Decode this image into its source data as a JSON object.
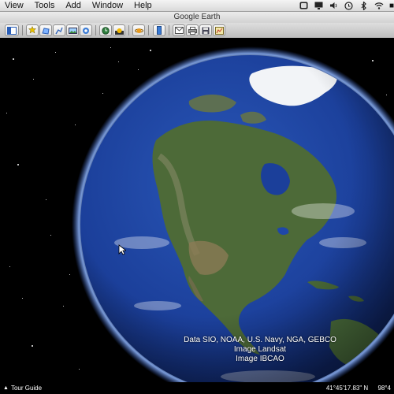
{
  "menu": {
    "items": [
      "View",
      "Tools",
      "Add",
      "Window",
      "Help"
    ]
  },
  "status": {
    "icons": [
      "app-status-icon",
      "display-icon",
      "volume-icon",
      "clock-icon",
      "bluetooth-icon",
      "wifi-icon",
      "battery-icon"
    ],
    "battery": "■"
  },
  "window": {
    "title": "Google Earth"
  },
  "toolbar": {
    "buttons": [
      "sidebar-toggle-icon",
      "placemark-icon",
      "polygon-icon",
      "path-icon",
      "image-overlay-icon",
      "record-tour-icon",
      "historical-imagery-icon",
      "sunlight-icon",
      "planets-icon",
      "ruler-icon",
      "email-icon",
      "print-icon",
      "save-image-icon",
      "view-in-maps-icon"
    ]
  },
  "attribution": {
    "line1": "Data SIO, NOAA, U.S. Navy, NGA, GEBCO",
    "line2": "Image Landsat",
    "line3": "Image IBCAO"
  },
  "bottom": {
    "tour_guide": "Tour Guide",
    "latitude": "41°45'17.83\" N",
    "longitude": "98°4"
  },
  "colors": {
    "ocean": "#1b3f9a",
    "atmosphere": "#6f9cff",
    "land": "#4d6a38",
    "ice": "#f2f4f7"
  }
}
